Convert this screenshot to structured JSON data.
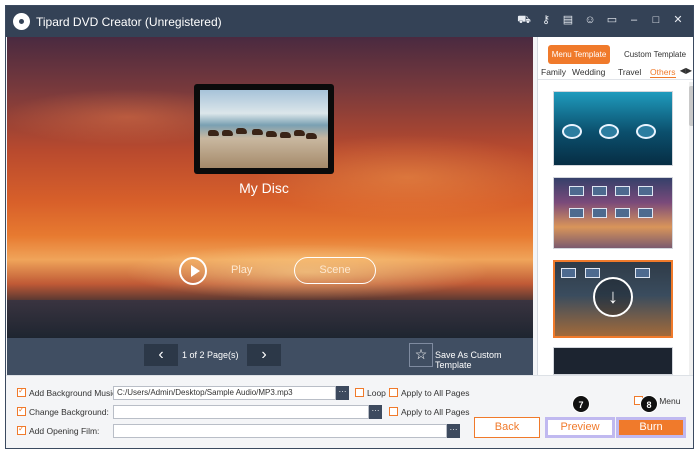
{
  "app": {
    "title": "Tipard DVD Creator (Unregistered)"
  },
  "titlebar_icons": [
    "cart-icon",
    "key-icon",
    "file-icon",
    "person-icon",
    "feedback-icon",
    "minimize-icon",
    "maximize-icon",
    "close-icon"
  ],
  "preview": {
    "disc_title": "My Disc",
    "play_label": "Play",
    "scene_label": "Scene",
    "page_info": "1 of 2 Page(s)",
    "save_template": "Save As Custom Template"
  },
  "panel": {
    "tabs": [
      "Menu Template",
      "Custom Template"
    ],
    "categories": [
      "Family",
      "Wedding",
      "Travel",
      "Others"
    ],
    "active_category": "Others"
  },
  "bottom": {
    "bg_music_label": "Add Background Music:",
    "bg_music_value": "C:/Users/Admin/Desktop/Sample Audio/MP3.mp3",
    "loop_label": "Loop",
    "apply_all_label": "Apply to All Pages",
    "change_bg_label": "Change Background:",
    "opening_film_label": "Add Opening Film:",
    "no_menu_label": "No Menu",
    "back_label": "Back",
    "preview_label": "Preview",
    "burn_label": "Burn",
    "badge_preview": "7",
    "badge_burn": "8",
    "dots": "···"
  },
  "colors": {
    "accent": "#f07a2b",
    "titlebar": "#344256",
    "highlight": "#c0b9f0"
  }
}
